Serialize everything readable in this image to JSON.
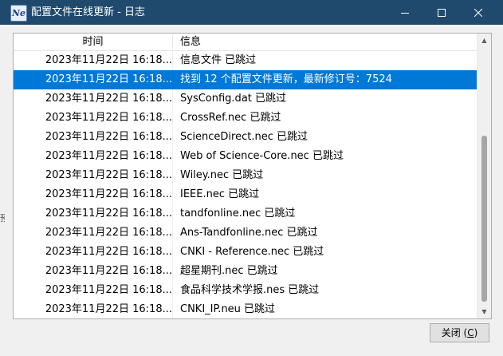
{
  "window": {
    "title": "配置文件在线更新 - 日志",
    "app_icon": "Ne"
  },
  "table": {
    "columns": {
      "time": "时间",
      "info": "信息"
    },
    "rows": [
      {
        "time": "2023年11月22日 16:18...",
        "info": "信息文件 已跳过",
        "selected": false
      },
      {
        "time": "2023年11月22日 16:18...",
        "info": "找到 12 个配置文件更新，最新修订号：7524",
        "selected": true
      },
      {
        "time": "2023年11月22日 16:18...",
        "info": "SysConfig.dat 已跳过",
        "selected": false
      },
      {
        "time": "2023年11月22日 16:18...",
        "info": "CrossRef.nec 已跳过",
        "selected": false
      },
      {
        "time": "2023年11月22日 16:18...",
        "info": "ScienceDirect.nec 已跳过",
        "selected": false
      },
      {
        "time": "2023年11月22日 16:18...",
        "info": "Web of Science-Core.nec 已跳过",
        "selected": false
      },
      {
        "time": "2023年11月22日 16:18...",
        "info": "Wiley.nec 已跳过",
        "selected": false
      },
      {
        "time": "2023年11月22日 16:18...",
        "info": "IEEE.nec 已跳过",
        "selected": false
      },
      {
        "time": "2023年11月22日 16:18...",
        "info": "tandfonline.nec 已跳过",
        "selected": false
      },
      {
        "time": "2023年11月22日 16:18...",
        "info": "Ans-Tandfonline.nec 已跳过",
        "selected": false
      },
      {
        "time": "2023年11月22日 16:18...",
        "info": "CNKI - Reference.nec 已跳过",
        "selected": false
      },
      {
        "time": "2023年11月22日 16:18...",
        "info": "超星期刊.nec 已跳过",
        "selected": false
      },
      {
        "time": "2023年11月22日 16:18...",
        "info": "食品科学技术学报.nes 已跳过",
        "selected": false
      },
      {
        "time": "2023年11月22日 16:18...",
        "info": "CNKI_IP.neu 已跳过",
        "selected": false
      }
    ]
  },
  "buttons": {
    "close_label": "关闭 (",
    "close_mnemonic": "C",
    "close_suffix": ")"
  },
  "background": {
    "left_fragment": "预"
  },
  "colors": {
    "titlebar": "#1f4a6e",
    "selection": "#0078d7"
  },
  "icons": {
    "minimize": "minimize-icon",
    "maximize": "maximize-icon",
    "close": "close-icon"
  }
}
